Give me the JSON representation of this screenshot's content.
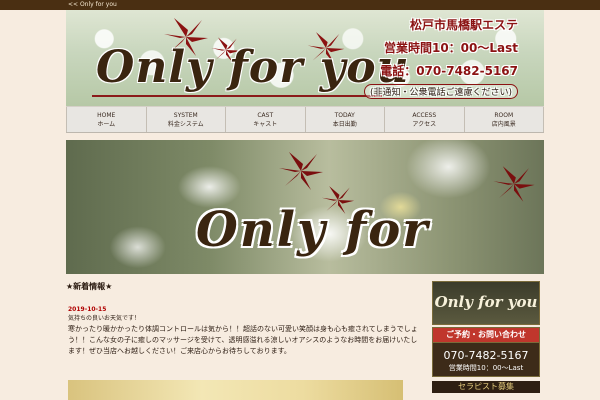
{
  "topbar": {
    "text": "<< Only for you"
  },
  "header": {
    "logo": "Only for you",
    "location": "松戸市馬橋駅エステ",
    "hours": "営業時間10：00〜Last",
    "phone": "電話：070-7482-5167",
    "note": "(非通知・公衆電話ご遠慮ください)"
  },
  "nav": {
    "items": [
      {
        "en": "HOME",
        "ja": "ホーム"
      },
      {
        "en": "SYSTEM",
        "ja": "料金システム"
      },
      {
        "en": "CAST",
        "ja": "キャスト"
      },
      {
        "en": "TODAY",
        "ja": "本日出勤"
      },
      {
        "en": "ACCESS",
        "ja": "アクセス"
      },
      {
        "en": "ROOM",
        "ja": "店内風景"
      }
    ]
  },
  "hero": {
    "logo": "Only for you"
  },
  "news": {
    "title": "★新着情報★",
    "date": "2019-10-15",
    "headline": "気持ちの良いお天気です！",
    "body": "寒かったり暖かかったり体調コントロールは気から！！超話のない可愛い笑顔は身も心も癒されてしまうでしょう！！こんな女の子に癒しのマッサージを受けて、透明感溢れる涼しいオアシスのようなお時間をお届けいたします！ぜひ当店へお越しください！ご来店心からお待ちしております。"
  },
  "sidebar": {
    "banner_logo": "Only for you",
    "contact_head": "ご予約・お問い合わせ",
    "phone": "070-7482-5167",
    "hours": "営業時間10：00〜Last",
    "banner2": "セラピスト募集"
  }
}
